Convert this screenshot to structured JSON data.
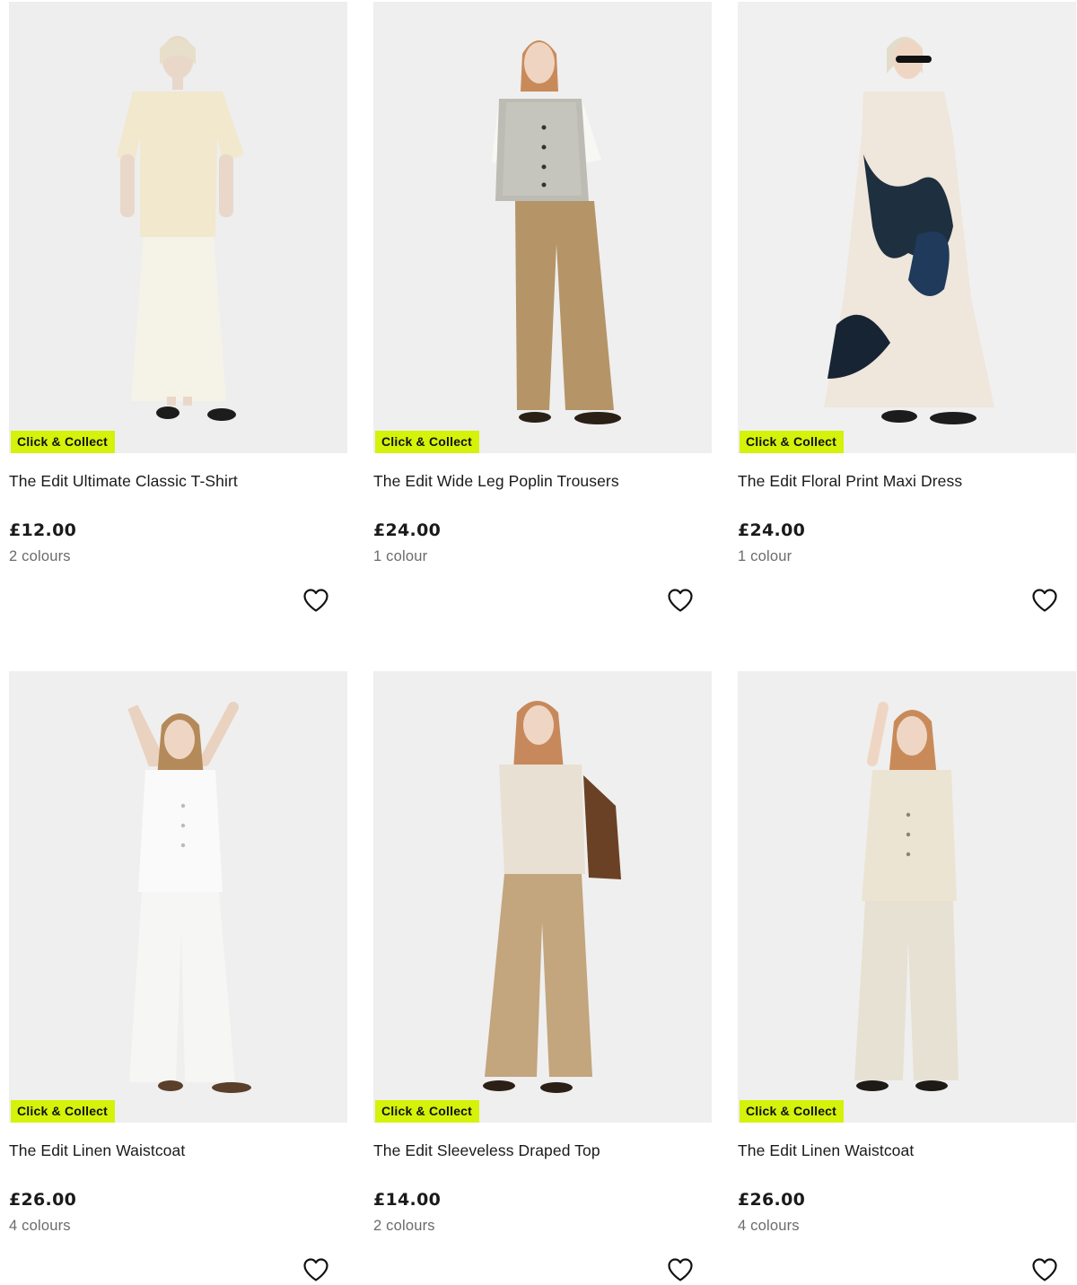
{
  "products": [
    {
      "badge": "Click & Collect",
      "title": "The Edit Ultimate Classic T-Shirt",
      "price": "£12.00",
      "colours": "2 colours",
      "wishlist_icon": "heart-outline-icon"
    },
    {
      "badge": "Click & Collect",
      "title": "The Edit Wide Leg Poplin Trousers",
      "price": "£24.00",
      "colours": "1 colour",
      "wishlist_icon": "heart-outline-icon"
    },
    {
      "badge": "Click & Collect",
      "title": "The Edit Floral Print Maxi Dress",
      "price": "£24.00",
      "colours": "1 colour",
      "wishlist_icon": "heart-outline-icon"
    },
    {
      "badge": "Click & Collect",
      "title": "The Edit Linen Waistcoat",
      "price": "£26.00",
      "colours": "4 colours",
      "wishlist_icon": "heart-outline-icon"
    },
    {
      "badge": "Click & Collect",
      "title": "The Edit Sleeveless Draped Top",
      "price": "£14.00",
      "colours": "2 colours",
      "wishlist_icon": "heart-outline-icon"
    },
    {
      "badge": "Click & Collect",
      "title": "The Edit Linen Waistcoat",
      "price": "£26.00",
      "colours": "4 colours",
      "wishlist_icon": "heart-outline-icon"
    }
  ],
  "colors": {
    "badge_bg": "#d4f20a",
    "image_bg": "#efefef",
    "text": "#1a1a1a",
    "muted": "#6b6b6b"
  }
}
